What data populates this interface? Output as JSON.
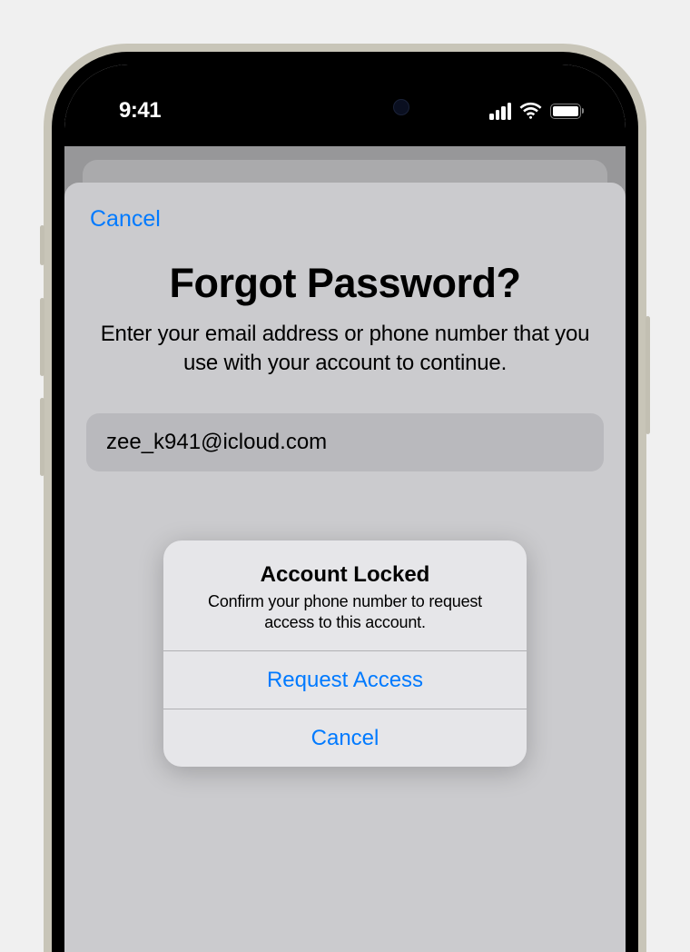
{
  "status": {
    "time": "9:41"
  },
  "sheet": {
    "cancel": "Cancel",
    "title": "Forgot Password?",
    "subtitle": "Enter your email address or phone number that you use with your account to continue.",
    "input_value": "zee_k941@icloud.com"
  },
  "alert": {
    "title": "Account Locked",
    "message": "Confirm your phone number to request access to this account.",
    "primary": "Request Access",
    "cancel": "Cancel"
  }
}
